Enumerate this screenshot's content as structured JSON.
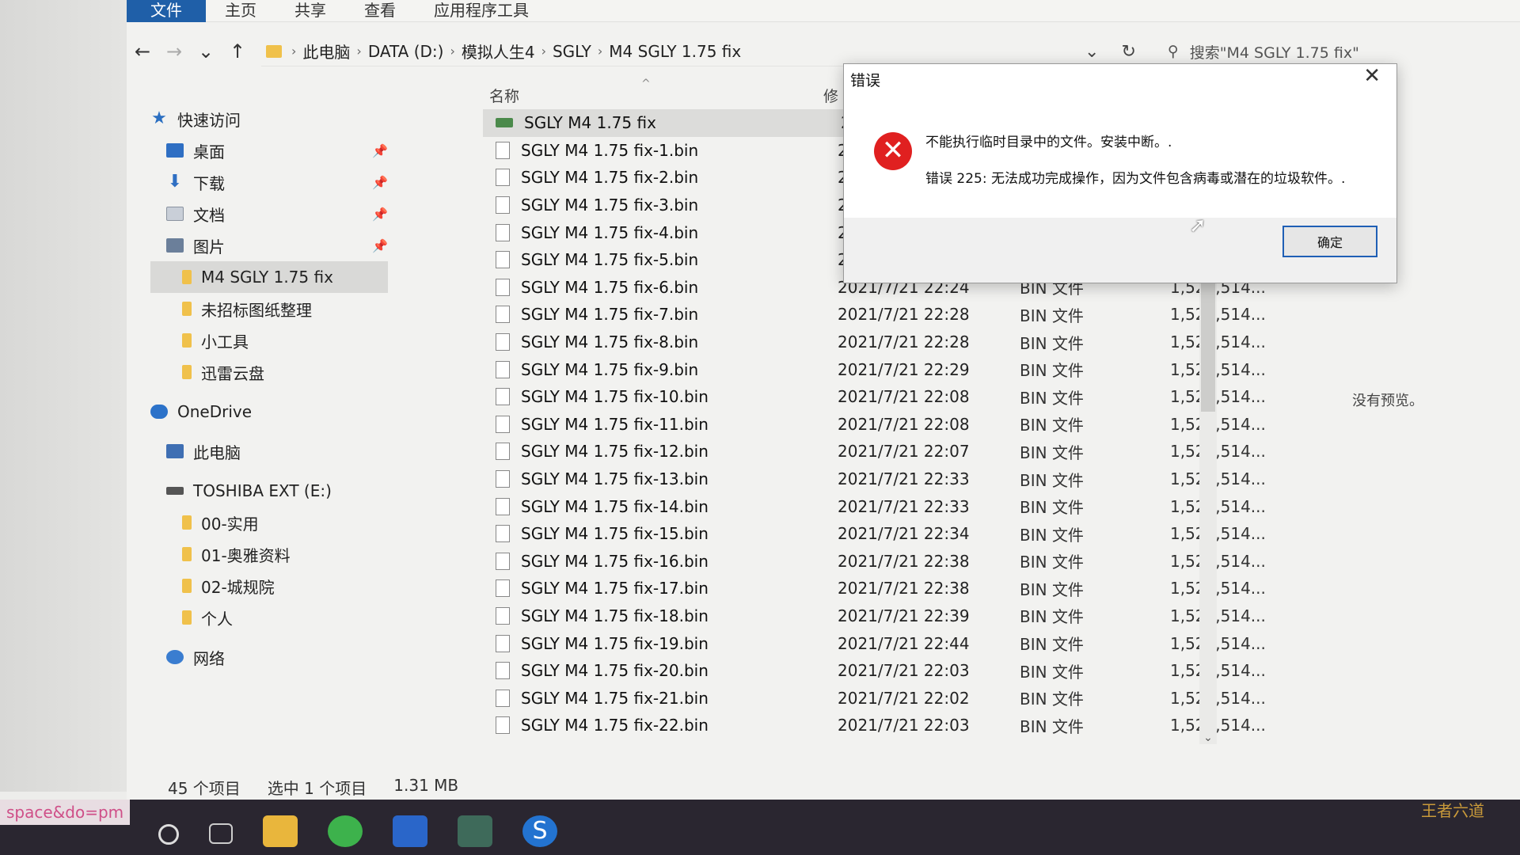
{
  "ribbon": {
    "tabs": [
      "文件",
      "主页",
      "共享",
      "查看",
      "应用程序工具"
    ]
  },
  "nav": {
    "back": "←",
    "forward": "→",
    "recent": "⌄",
    "up": "↑",
    "breadcrumb": [
      "此电脑",
      "DATA (D:)",
      "模拟人生4",
      "SGLY",
      "M4 SGLY 1.75 fix"
    ],
    "sep": "›",
    "dropdown": "⌄",
    "refresh": "↻",
    "search_icon": "⚲",
    "search_placeholder": "搜索\"M4 SGLY 1.75 fix\""
  },
  "sidebar": {
    "quick_access": "快速访问",
    "pinned": [
      {
        "label": "桌面",
        "icon": "desktop-icon"
      },
      {
        "label": "下载",
        "icon": "download-icon"
      },
      {
        "label": "文档",
        "icon": "documents-icon"
      },
      {
        "label": "图片",
        "icon": "pictures-icon"
      }
    ],
    "pin_glyph": "📌",
    "folders": [
      "M4 SGLY 1.75 fix",
      "未招标图纸整理",
      "小工具",
      "迅雷云盘"
    ],
    "onedrive": "OneDrive",
    "this_pc": "此电脑",
    "drive": "TOSHIBA EXT (E:)",
    "drive_folders": [
      "00-实用",
      "01-奥雅资料",
      "02-城规院",
      "个人"
    ],
    "network": "网络"
  },
  "columns": {
    "name": "名称",
    "modified_partial": "修",
    "sort_glyph": "^"
  },
  "files": [
    {
      "name": "SGLY M4 1.75 fix",
      "date": "20",
      "type": "",
      "size": "",
      "app": true,
      "selected": true
    },
    {
      "name": "SGLY M4 1.75 fix-1.bin",
      "date": "20",
      "type": "",
      "size": ""
    },
    {
      "name": "SGLY M4 1.75 fix-2.bin",
      "date": "20",
      "type": "",
      "size": ""
    },
    {
      "name": "SGLY M4 1.75 fix-3.bin",
      "date": "20",
      "type": "",
      "size": ""
    },
    {
      "name": "SGLY M4 1.75 fix-4.bin",
      "date": "20",
      "type": "",
      "size": ""
    },
    {
      "name": "SGLY M4 1.75 fix-5.bin",
      "date": "20",
      "type": "",
      "size": ""
    },
    {
      "name": "SGLY M4 1.75 fix-6.bin",
      "date": "2021/7/21 22:24",
      "type": "BIN 文件",
      "size": "1,521,514..."
    },
    {
      "name": "SGLY M4 1.75 fix-7.bin",
      "date": "2021/7/21 22:28",
      "type": "BIN 文件",
      "size": "1,521,514..."
    },
    {
      "name": "SGLY M4 1.75 fix-8.bin",
      "date": "2021/7/21 22:28",
      "type": "BIN 文件",
      "size": "1,521,514..."
    },
    {
      "name": "SGLY M4 1.75 fix-9.bin",
      "date": "2021/7/21 22:29",
      "type": "BIN 文件",
      "size": "1,521,514..."
    },
    {
      "name": "SGLY M4 1.75 fix-10.bin",
      "date": "2021/7/21 22:08",
      "type": "BIN 文件",
      "size": "1,521,514..."
    },
    {
      "name": "SGLY M4 1.75 fix-11.bin",
      "date": "2021/7/21 22:08",
      "type": "BIN 文件",
      "size": "1,521,514..."
    },
    {
      "name": "SGLY M4 1.75 fix-12.bin",
      "date": "2021/7/21 22:07",
      "type": "BIN 文件",
      "size": "1,521,514..."
    },
    {
      "name": "SGLY M4 1.75 fix-13.bin",
      "date": "2021/7/21 22:33",
      "type": "BIN 文件",
      "size": "1,521,514..."
    },
    {
      "name": "SGLY M4 1.75 fix-14.bin",
      "date": "2021/7/21 22:33",
      "type": "BIN 文件",
      "size": "1,521,514..."
    },
    {
      "name": "SGLY M4 1.75 fix-15.bin",
      "date": "2021/7/21 22:34",
      "type": "BIN 文件",
      "size": "1,521,514..."
    },
    {
      "name": "SGLY M4 1.75 fix-16.bin",
      "date": "2021/7/21 22:38",
      "type": "BIN 文件",
      "size": "1,521,514..."
    },
    {
      "name": "SGLY M4 1.75 fix-17.bin",
      "date": "2021/7/21 22:38",
      "type": "BIN 文件",
      "size": "1,521,514..."
    },
    {
      "name": "SGLY M4 1.75 fix-18.bin",
      "date": "2021/7/21 22:39",
      "type": "BIN 文件",
      "size": "1,521,514..."
    },
    {
      "name": "SGLY M4 1.75 fix-19.bin",
      "date": "2021/7/21 22:44",
      "type": "BIN 文件",
      "size": "1,521,514..."
    },
    {
      "name": "SGLY M4 1.75 fix-20.bin",
      "date": "2021/7/21 22:03",
      "type": "BIN 文件",
      "size": "1,521,514..."
    },
    {
      "name": "SGLY M4 1.75 fix-21.bin",
      "date": "2021/7/21 22:02",
      "type": "BIN 文件",
      "size": "1,521,514..."
    },
    {
      "name": "SGLY M4 1.75 fix-22.bin",
      "date": "2021/7/21 22:03",
      "type": "BIN 文件",
      "size": "1,521,514..."
    }
  ],
  "scroll_down": "⌄",
  "preview": "没有预览。",
  "status": {
    "count": "45 个项目",
    "selection": "选中 1 个项目",
    "size": "1.31 MB"
  },
  "taskbar": {
    "url_fragment": "space&do=pm",
    "icons": [
      "search-icon",
      "task-view-icon",
      "file-explorer-icon",
      "wechat-icon",
      "feishu-icon",
      "app-icon",
      "sogou-icon"
    ],
    "sogou_letter": "S"
  },
  "watermark": "王者六道",
  "dialog": {
    "title": "错误",
    "close": "✕",
    "icon_glyph": "✕",
    "message1": "不能执行临时目录中的文件。安装中断。.",
    "message2": "错误 225: 无法成功完成操作，因为文件包含病毒或潜在的垃圾软件。.",
    "ok": "确定"
  },
  "colors": {
    "accent": "#1f5fa8",
    "error": "#e02020"
  }
}
